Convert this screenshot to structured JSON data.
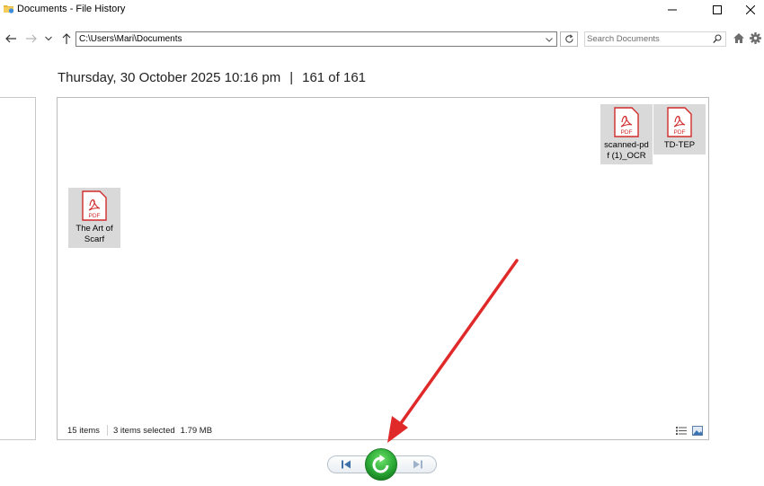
{
  "window": {
    "title": "Documents - File History"
  },
  "nav": {
    "address": "C:\\Users\\Mari\\Documents",
    "search_placeholder": "Search Documents"
  },
  "header": {
    "datetime": "Thursday, 30 October 2025 10:16 pm",
    "separator": "|",
    "position": "161 of 161"
  },
  "files": [
    {
      "name_line1": "scanned-pd",
      "name_line2": "f (1)_OCR",
      "badge": "PDF",
      "icon": "pdf-file-icon"
    },
    {
      "name_line1": "TD-TEP",
      "name_line2": "",
      "badge": "PDF",
      "icon": "pdf-file-icon"
    },
    {
      "name_line1": "The Art of",
      "name_line2": "Scarf",
      "badge": "PDF",
      "icon": "pdf-file-icon"
    }
  ],
  "status": {
    "item_count": "15 items",
    "selected": "3 items selected",
    "size": "1.79 MB"
  },
  "colors": {
    "pdf_red": "#d12b2b",
    "tile_bg": "#d9d9d9",
    "restore_green": "#2eae3a",
    "annotation_arrow": "#e02a2a"
  },
  "icons": {
    "back": "back-arrow-icon",
    "forward": "forward-arrow-icon",
    "recent": "chevron-down-icon",
    "up": "up-arrow-icon",
    "refresh": "refresh-icon",
    "search": "search-icon",
    "home": "home-icon",
    "settings": "gear-icon",
    "previous": "previous-version-icon",
    "restore": "restore-icon",
    "next": "next-version-icon"
  }
}
